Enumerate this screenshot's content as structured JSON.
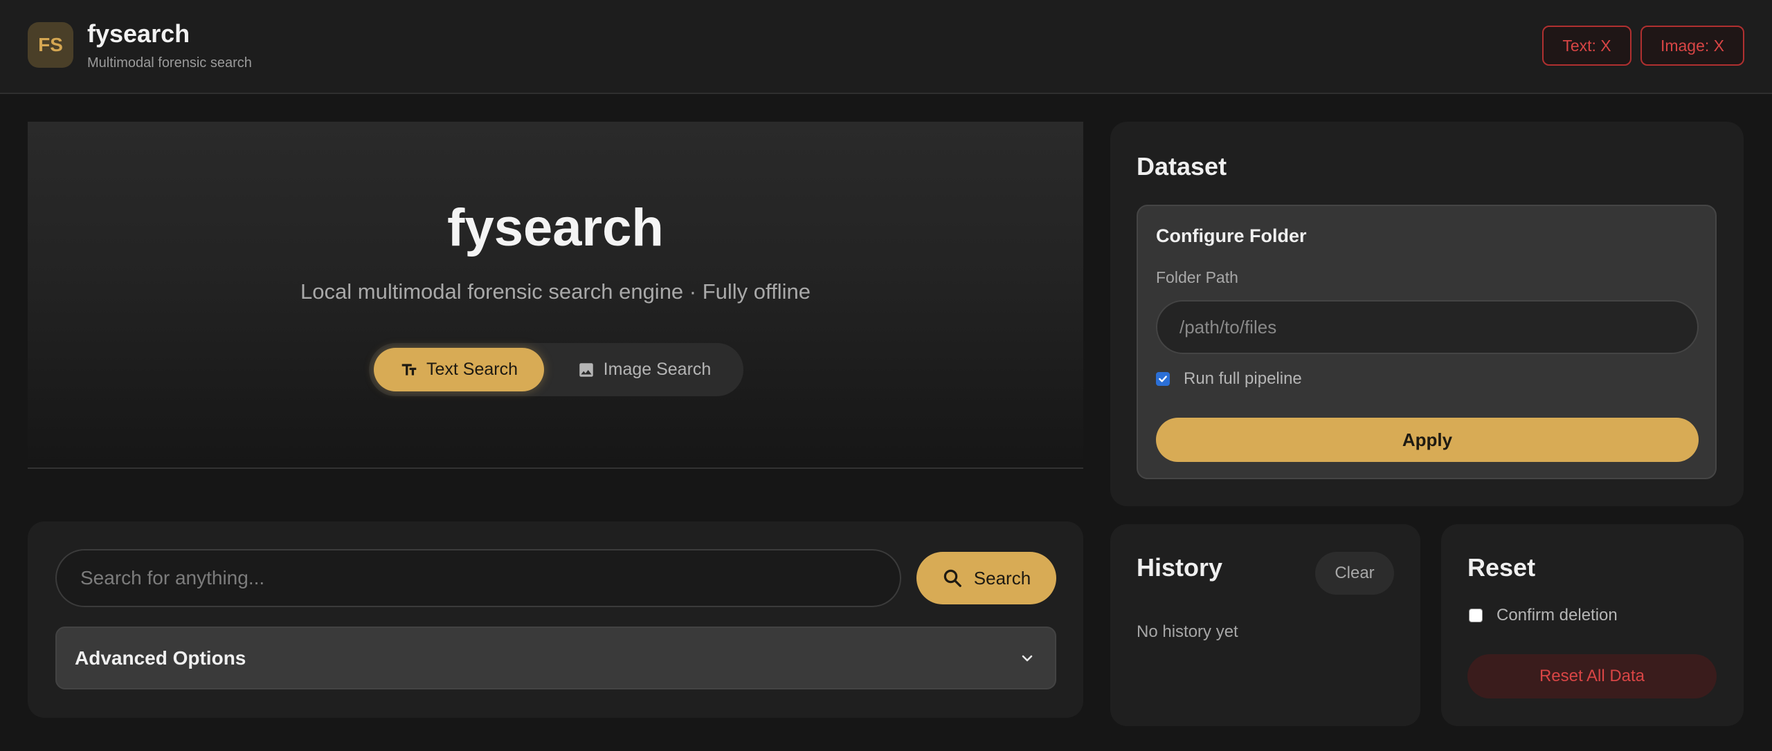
{
  "header": {
    "logo_text": "FS",
    "title": "fysearch",
    "subtitle": "Multimodal forensic search",
    "status_text": "Text: X",
    "status_image": "Image: X"
  },
  "hero": {
    "title": "fysearch",
    "subtitle": "Local multimodal forensic search engine · Fully offline",
    "modes": {
      "text_label": "Text Search",
      "image_label": "Image Search",
      "active": "text"
    }
  },
  "search": {
    "placeholder": "Search for anything...",
    "button_label": "Search",
    "advanced_label": "Advanced Options"
  },
  "dataset": {
    "title": "Dataset",
    "config_title": "Configure Folder",
    "folder_label": "Folder Path",
    "folder_placeholder": "/path/to/files",
    "pipeline_label": "Run full pipeline",
    "pipeline_checked": true,
    "apply_label": "Apply"
  },
  "history": {
    "title": "History",
    "clear_label": "Clear",
    "empty_text": "No history yet"
  },
  "reset": {
    "title": "Reset",
    "confirm_label": "Confirm deletion",
    "confirm_checked": false,
    "button_label": "Reset All Data"
  },
  "colors": {
    "accent": "#d8ab55",
    "danger": "#d84545",
    "background": "#161616",
    "card": "#1f1f1f"
  },
  "icons": {
    "text_mode": "text-format-icon",
    "image_mode": "image-icon",
    "search": "search-icon",
    "advanced": "chevron-down-icon"
  }
}
